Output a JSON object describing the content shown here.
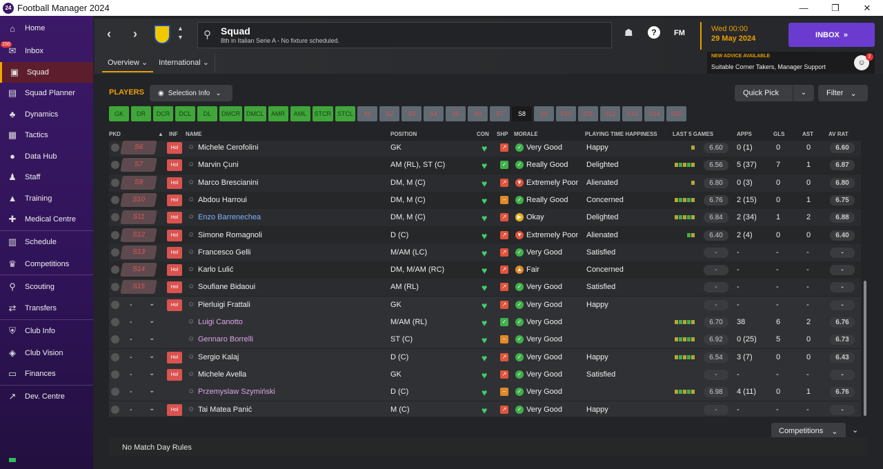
{
  "window": {
    "app_icon": "24",
    "title": "Football Manager 2024",
    "minimize": "—",
    "restore": "❐",
    "close": "✕"
  },
  "sidebar": {
    "items": [
      {
        "label": "Home",
        "icon": "⌂"
      },
      {
        "label": "Inbox",
        "icon": "✉",
        "badge": "150"
      },
      {
        "label": "Squad",
        "icon": "▣"
      },
      {
        "label": "Squad Planner",
        "icon": "▤"
      },
      {
        "label": "Dynamics",
        "icon": "♣"
      },
      {
        "label": "Tactics",
        "icon": "▦"
      },
      {
        "label": "Data Hub",
        "icon": "●"
      },
      {
        "label": "Staff",
        "icon": "♟"
      },
      {
        "label": "Training",
        "icon": "▲"
      },
      {
        "label": "Medical Centre",
        "icon": "✚"
      },
      {
        "label": "Schedule",
        "icon": "▥"
      },
      {
        "label": "Competitions",
        "icon": "♛"
      },
      {
        "label": "Scouting",
        "icon": "⚲"
      },
      {
        "label": "Transfers",
        "icon": "⇄"
      },
      {
        "label": "Club Info",
        "icon": "⛨"
      },
      {
        "label": "Club Vision",
        "icon": "◈"
      },
      {
        "label": "Finances",
        "icon": "▭"
      },
      {
        "label": "Dev. Centre",
        "icon": "↗"
      }
    ]
  },
  "header": {
    "title": "Squad",
    "subtitle": "8th in Italian Serie A - No fixture scheduled.",
    "fm": "FM",
    "help": "?",
    "time": "Wed 00:00",
    "date": "29 May 2024",
    "inbox_label": "INBOX",
    "inbox_arrows": "»",
    "advice_title": "NEW ADVICE AVAILABLE",
    "advice_text": "Suitable Corner Takers, Manager Support",
    "advice_count": "2",
    "tabs": [
      "Overview",
      "International"
    ]
  },
  "toolbar": {
    "players_label": "PLAYERS",
    "selection_info": "Selection Info",
    "quick_pick": "Quick Pick",
    "filter": "Filter"
  },
  "positions": [
    "GK",
    "DR",
    "DCR",
    "DCL",
    "DL",
    "DMCR",
    "DMCL",
    "AMR",
    "AML",
    "STCR",
    "STCL",
    "S1",
    "S2",
    "S3",
    "S4",
    "S5",
    "S6",
    "S7",
    "S8",
    "S9",
    "S10",
    "S11",
    "S12",
    "S13",
    "S14",
    "S15"
  ],
  "columns": {
    "pkd": "PKD",
    "inf": "INF",
    "name": "NAME",
    "position": "POSITION",
    "con": "CON",
    "shp": "SHP",
    "morale": "MORALE",
    "pth": "PLAYING TIME HAPPINESS",
    "last5": "LAST 5 GAMES",
    "apps": "APPS",
    "gls": "GLS",
    "ast": "AST",
    "avrat": "AV RAT"
  },
  "players": [
    {
      "slot": "S6",
      "hol": "Hol",
      "name": "Michele Cerofolini",
      "pos": "GK",
      "morale": "Very Good",
      "pth": "Happy",
      "form": "6.60",
      "apps": "0 (1)",
      "gls": "0",
      "ast": "0",
      "avr": "6.60"
    },
    {
      "slot": "S7",
      "hol": "Hol",
      "name": "Marvin Çuni",
      "pos": "AM (RL), ST (C)",
      "morale": "Really Good",
      "pth": "Delighted",
      "form": "6.56",
      "apps": "5 (37)",
      "gls": "7",
      "ast": "1",
      "avr": "6.87"
    },
    {
      "slot": "S9",
      "hol": "Hol",
      "name": "Marco Brescianini",
      "pos": "DM, M (C)",
      "morale": "Extremely Poor",
      "pth": "Alienated",
      "form": "6.80",
      "apps": "0 (3)",
      "gls": "0",
      "ast": "0",
      "avr": "6.80"
    },
    {
      "slot": "S10",
      "hol": "Hol",
      "name": "Abdou Harroui",
      "pos": "DM, M (C)",
      "morale": "Really Good",
      "pth": "Concerned",
      "form": "6.76",
      "apps": "2 (15)",
      "gls": "0",
      "ast": "1",
      "avr": "6.75"
    },
    {
      "slot": "S11",
      "hol": "Hol",
      "name": "Enzo Barrenechea",
      "pos": "DM, M (C)",
      "morale": "Okay",
      "pth": "Delighted",
      "form": "6.84",
      "apps": "2 (34)",
      "gls": "1",
      "ast": "2",
      "avr": "6.88"
    },
    {
      "slot": "S12",
      "hol": "Hol",
      "name": "Simone Romagnoli",
      "pos": "D (C)",
      "morale": "Extremely Poor",
      "pth": "Alienated",
      "form": "6.40",
      "apps": "2 (4)",
      "gls": "0",
      "ast": "0",
      "avr": "6.40"
    },
    {
      "slot": "S13",
      "hol": "Hol",
      "name": "Francesco Gelli",
      "pos": "M/AM (LC)",
      "morale": "Very Good",
      "pth": "Satisfied",
      "form": "-",
      "apps": "-",
      "gls": "-",
      "ast": "-",
      "avr": "-"
    },
    {
      "slot": "S14",
      "hol": "Hol",
      "name": "Karlo Lulić",
      "pos": "DM, M/AM (RC)",
      "morale": "Fair",
      "pth": "Concerned",
      "form": "-",
      "apps": "-",
      "gls": "-",
      "ast": "-",
      "avr": "-"
    },
    {
      "slot": "S15",
      "hol": "Hol",
      "name": "Soufiane Bidaoui",
      "pos": "AM (RL)",
      "morale": "Very Good",
      "pth": "Satisfied",
      "form": "-",
      "apps": "-",
      "gls": "-",
      "ast": "-",
      "avr": "-"
    },
    {
      "slot": "-",
      "hol": "Hol",
      "name": "Pierluigi Frattali",
      "pos": "GK",
      "morale": "Very Good",
      "pth": "Happy",
      "form": "-",
      "apps": "-",
      "gls": "-",
      "ast": "-",
      "avr": "-"
    },
    {
      "slot": "-",
      "hol": "",
      "name": "Luigi Canotto",
      "pos": "M/AM (RL)",
      "morale": "Very Good",
      "pth": "",
      "form": "6.70",
      "apps": "38",
      "gls": "6",
      "ast": "2",
      "avr": "6.76"
    },
    {
      "slot": "-",
      "hol": "",
      "name": "Gennaro Borrelli",
      "pos": "ST (C)",
      "morale": "Very Good",
      "pth": "",
      "form": "6.92",
      "apps": "0 (25)",
      "gls": "5",
      "ast": "0",
      "avr": "6.73"
    },
    {
      "slot": "-",
      "hol": "Hol",
      "name": "Sergio Kalaj",
      "pos": "D (C)",
      "morale": "Very Good",
      "pth": "Happy",
      "form": "6.54",
      "apps": "3 (7)",
      "gls": "0",
      "ast": "0",
      "avr": "6.43"
    },
    {
      "slot": "-",
      "hol": "Hol",
      "name": "Michele Avella",
      "pos": "GK",
      "morale": "Very Good",
      "pth": "Satisfied",
      "form": "-",
      "apps": "-",
      "gls": "-",
      "ast": "-",
      "avr": "-"
    },
    {
      "slot": "-",
      "hol": "",
      "name": "Przemyslaw Szymiński",
      "pos": "D (C)",
      "morale": "Very Good",
      "pth": "",
      "form": "6.98",
      "apps": "4 (11)",
      "gls": "0",
      "ast": "1",
      "avr": "6.76"
    },
    {
      "slot": "-",
      "hol": "Hol",
      "name": "Tai Matea Panić",
      "pos": "M (C)",
      "morale": "Very Good",
      "pth": "Happy",
      "form": "-",
      "apps": "-",
      "gls": "-",
      "ast": "-",
      "avr": "-"
    }
  ],
  "footer": {
    "no_match_day_rules": "No Match Day Rules",
    "competitions": "Competitions"
  }
}
